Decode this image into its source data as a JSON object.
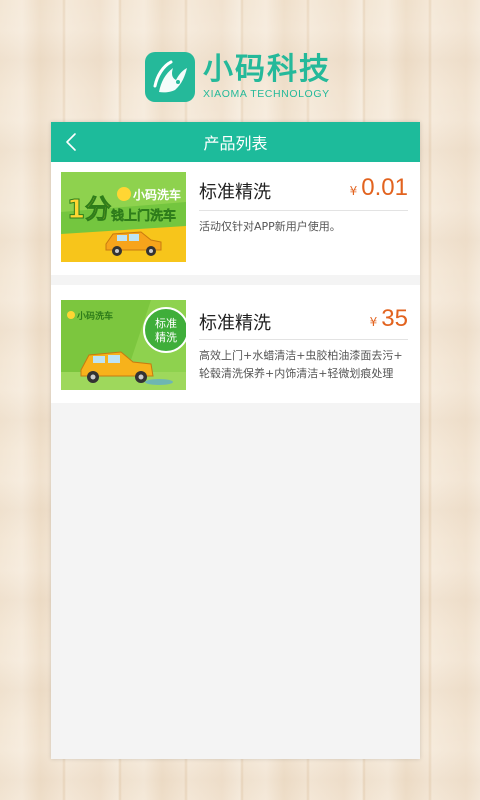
{
  "brand": {
    "name": "小码科技",
    "subtitle": "XIAOMA TECHNOLOGY",
    "accent": "#25b99a"
  },
  "header": {
    "title": "产品列表",
    "back_icon": "chevron-left-icon",
    "color": "#1dbb9b"
  },
  "products": [
    {
      "name": "标准精洗",
      "currency": "¥",
      "price": "0.01",
      "description": "活动仅针对APP新用户使用。",
      "image": {
        "big_text": "1分",
        "brand_text": "小码洗车",
        "slogan": "钱上门洗车"
      }
    },
    {
      "name": "标准精洗",
      "currency": "¥",
      "price": "35",
      "description_lines": [
        "高效上门+水蜡清洁+虫胶柏油漆面去污+",
        "轮毂清洗保养+内饰清洁+轻微划痕处理"
      ],
      "image": {
        "brand_text": "小码洗车",
        "badge_line1": "标准",
        "badge_line2": "精洗"
      }
    }
  ],
  "price_color": "#e2631f"
}
